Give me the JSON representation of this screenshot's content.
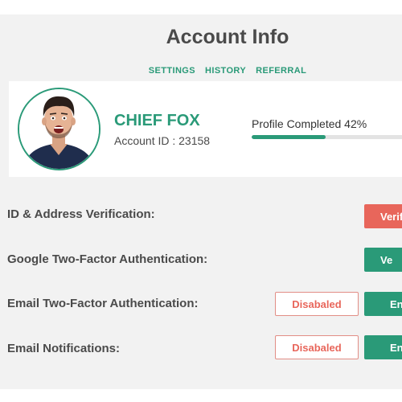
{
  "page": {
    "title": "Account Info"
  },
  "tabs": [
    {
      "label": "SETTINGS"
    },
    {
      "label": "HISTORY"
    },
    {
      "label": "REFERRAL"
    }
  ],
  "profile": {
    "name": "CHIEF FOX",
    "account_id_label": "Account ID : 23158",
    "progress_label": "Profile Completed 42%",
    "progress_value": 42
  },
  "settings": [
    {
      "label": "ID & Address Verification:",
      "action": "Verif"
    },
    {
      "label": "Google Two-Factor Authentication:",
      "action": "Ve"
    },
    {
      "label": "Email Two-Factor Authentication:",
      "status": "Disabaled",
      "action": "En"
    },
    {
      "label": "Email Notifications:",
      "status": "Disabaled",
      "action": "En"
    }
  ],
  "colors": {
    "accent": "#2a9a78",
    "danger": "#e8665b",
    "text": "#4a4a4a",
    "panel_bg": "#f2f2f2"
  }
}
